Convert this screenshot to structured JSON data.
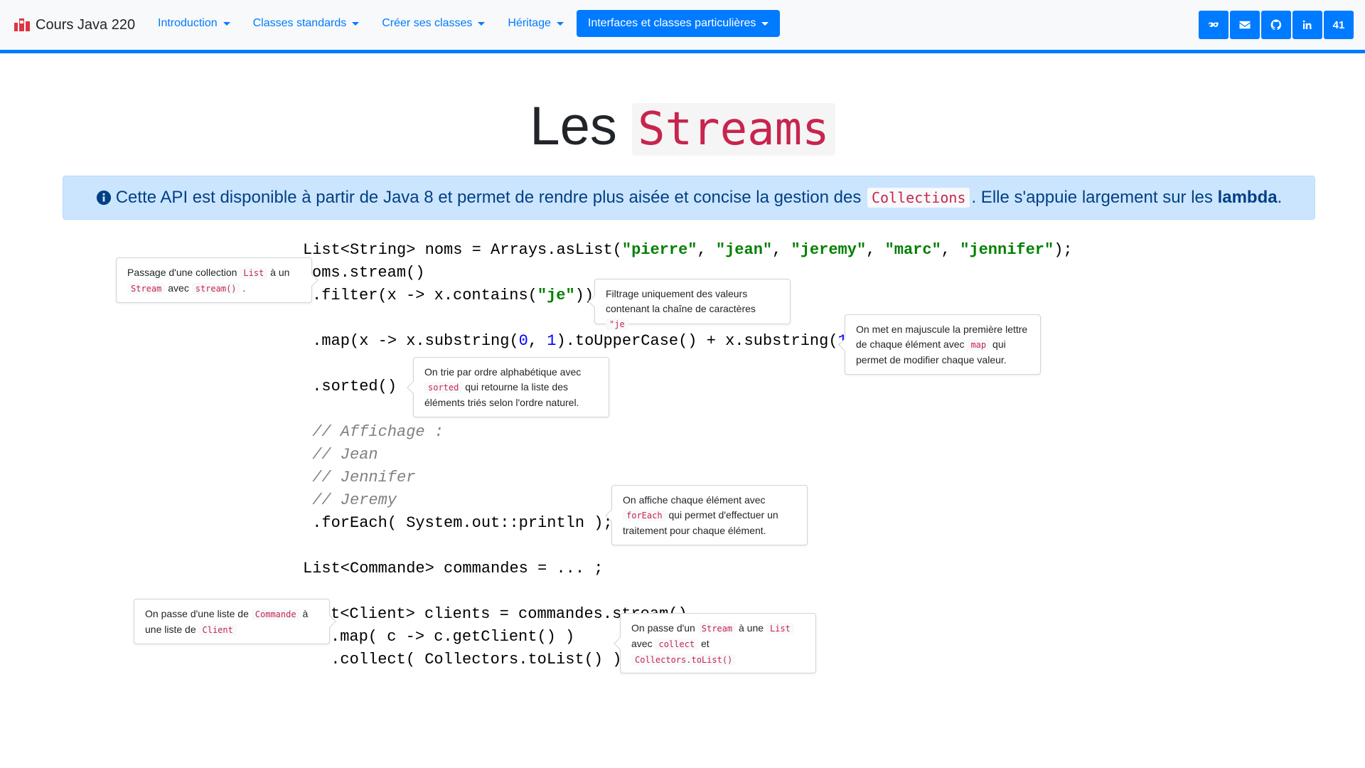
{
  "navbar": {
    "brand": "Cours Java 220",
    "menu": [
      {
        "label": "Introduction",
        "active": false
      },
      {
        "label": "Classes standards",
        "active": false
      },
      {
        "label": "Créer ses classes",
        "active": false
      },
      {
        "label": "Héritage",
        "active": false
      },
      {
        "label": "Interfaces et classes particulières",
        "active": true
      }
    ],
    "right_icons": [
      "mask-icon",
      "envelope-icon",
      "github-icon",
      "linkedin-icon"
    ],
    "page_number": "41",
    "accent_color": "#007bff"
  },
  "title": {
    "prefix": "Les",
    "code": "Streams"
  },
  "alert": {
    "text_before": "Cette API est disponible à partir de Java 8 et permet de rendre plus aisée et concise la gestion des",
    "code": "Collections",
    "text_middle": ". Elle s'appuie largement sur les",
    "bold": "lambda",
    "text_after": "."
  },
  "code": {
    "l1_a": "List<String> noms = Arrays.asList(",
    "l1_s1": "\"pierre\"",
    "l1_c1": ", ",
    "l1_s2": "\"jean\"",
    "l1_c2": ", ",
    "l1_s3": "\"jeremy\"",
    "l1_c3": ", ",
    "l1_s4": "\"marc\"",
    "l1_c4": ", ",
    "l1_s5": "\"jennifer\"",
    "l1_end": ");",
    "l2": "oms.stream()",
    "l3_a": ".filter(x -> x.contains(",
    "l3_s": "\"je\"",
    "l3_b": "))",
    "l4_a": " .map(x -> x.substring(",
    "l4_n1": "0",
    "l4_b": ", ",
    "l4_n2": "1",
    "l4_c": ").toUpperCase() + x.substring(",
    "l4_n3": "1",
    "l4_d": ")",
    "l5": " .sorted()",
    "l6": " // Affichage :",
    "l7": " // Jean",
    "l8": " // Jennifer",
    "l9": " // Jeremy",
    "l10": " .forEach( System.out::println );",
    "l11": "List<Commande> commandes = ... ;",
    "l12": "t<Client> clients = commandes.stream()",
    "l13": ".map( c -> c.getClient() )",
    "l14": " .collect( Collectors.toList() );"
  },
  "tooltips": {
    "t1": {
      "a": "Passage d'une collection",
      "c1": "List",
      "b": "à un",
      "c2": "Stream",
      "d": "avec",
      "c3": "stream()",
      "e": "."
    },
    "t2": {
      "a": "Filtrage uniquement des valeurs contenant la chaîne de caractères",
      "c1": "\"je"
    },
    "t3": {
      "a": "On met en majuscule la première lettre de chaque élément avec",
      "c1": "map",
      "b": "qui permet de modifier chaque valeur."
    },
    "t4": {
      "a": "On trie par ordre alphabétique avec",
      "c1": "sorted",
      "b": "qui retourne la liste des éléments triés selon l'ordre naturel."
    },
    "t5": {
      "a": "On affiche chaque élément avec",
      "c1": "forEach",
      "b": "qui permet d'effectuer un traitement pour chaque élément."
    },
    "t6": {
      "a": "On passe d'une liste de",
      "c1": "Commande",
      "b": "à une liste de",
      "c2": "Client"
    },
    "t7": {
      "a": "On passe d'un",
      "c1": "Stream",
      "b": "à une",
      "c2": "List",
      "c": "avec",
      "c3": "collect",
      "d": "et",
      "c4": "Collectors.toList()"
    }
  }
}
